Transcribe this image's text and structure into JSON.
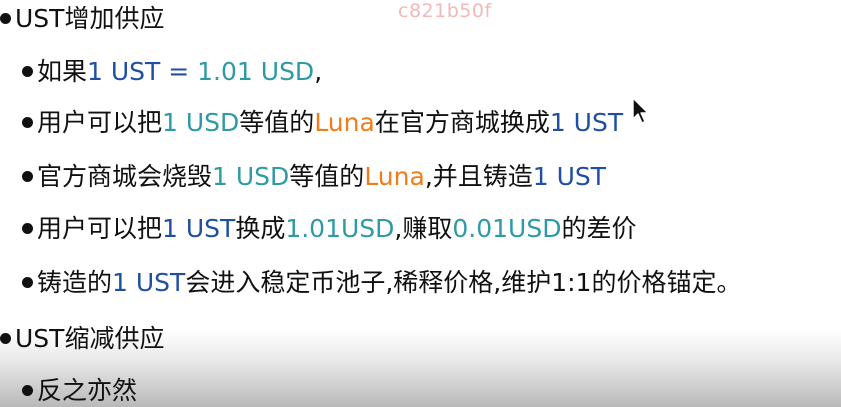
{
  "watermark": "c821b50f",
  "colors": {
    "text": "#111111",
    "blue": "#1f4fa3",
    "teal": "#2e9aa6",
    "orange": "#f07d1a"
  },
  "lines": [
    {
      "level": 1,
      "segments": [
        {
          "text": "UST增加供应",
          "color": "default"
        }
      ]
    },
    {
      "level": 2,
      "segments": [
        {
          "text": "如果",
          "color": "default"
        },
        {
          "text": "1 UST = ",
          "color": "blue"
        },
        {
          "text": "1.01 USD",
          "color": "teal"
        },
        {
          "text": ",",
          "color": "default"
        }
      ]
    },
    {
      "level": 2,
      "segments": [
        {
          "text": "用户可以把",
          "color": "default"
        },
        {
          "text": "1 USD",
          "color": "teal"
        },
        {
          "text": "等值的",
          "color": "default"
        },
        {
          "text": "Luna",
          "color": "orange"
        },
        {
          "text": "在官方商城换成",
          "color": "default"
        },
        {
          "text": "1 UST",
          "color": "blue"
        }
      ]
    },
    {
      "level": 2,
      "segments": [
        {
          "text": "官方商城会烧毁",
          "color": "default"
        },
        {
          "text": "1 USD",
          "color": "teal"
        },
        {
          "text": "等值的",
          "color": "default"
        },
        {
          "text": "Luna",
          "color": "orange"
        },
        {
          "text": ",并且铸造",
          "color": "default"
        },
        {
          "text": "1 UST",
          "color": "blue"
        }
      ]
    },
    {
      "level": 2,
      "segments": [
        {
          "text": "用户可以把",
          "color": "default"
        },
        {
          "text": "1 UST",
          "color": "blue"
        },
        {
          "text": "换成",
          "color": "default"
        },
        {
          "text": "1.01USD",
          "color": "teal"
        },
        {
          "text": ",赚取",
          "color": "default"
        },
        {
          "text": "0.01USD",
          "color": "teal"
        },
        {
          "text": "的差价",
          "color": "default"
        }
      ]
    },
    {
      "level": 2,
      "segments": [
        {
          "text": "铸造的",
          "color": "default"
        },
        {
          "text": "1 UST",
          "color": "blue"
        },
        {
          "text": "会进入稳定币池子,稀释价格,维护1:1的价格锚定。",
          "color": "default"
        }
      ]
    },
    {
      "level": 1,
      "segments": [
        {
          "text": "UST缩减供应",
          "color": "default"
        }
      ]
    },
    {
      "level": 2,
      "segments": [
        {
          "text": "反之亦然",
          "color": "default"
        }
      ]
    }
  ]
}
